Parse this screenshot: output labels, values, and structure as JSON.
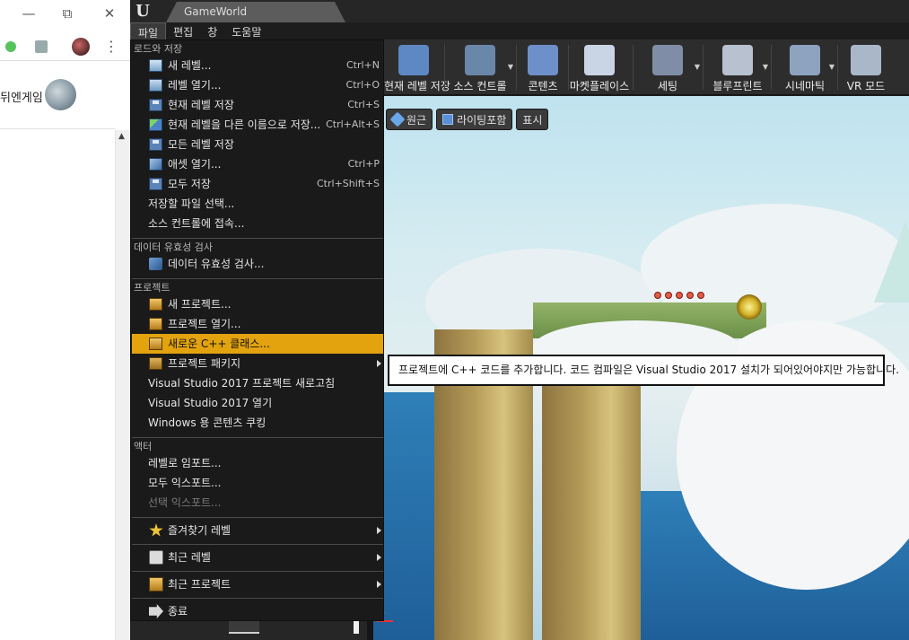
{
  "browser": {
    "window_controls": {
      "minimize": "—",
      "restore": "⧉",
      "close": "✕"
    },
    "kebab": "⋮",
    "site_name": "뒤엔게임",
    "scroll_up": "▲"
  },
  "editor": {
    "logo": "U",
    "tab_title": "GameWorld",
    "menubar": [
      {
        "label": "파일",
        "active": true
      },
      {
        "label": "편집"
      },
      {
        "label": "창"
      },
      {
        "label": "도움말"
      }
    ],
    "toolbar": [
      {
        "label": "현재 레벨 저장",
        "icon": "save-icon",
        "color": "#5d88c4"
      },
      {
        "label": "소스 컨트롤",
        "icon": "source-control-icon",
        "color": "#6a86a8",
        "caret": "▼"
      },
      {
        "label": "콘텐츠",
        "icon": "content-icon",
        "color": "#6d8fca"
      },
      {
        "label": "마켓플레이스",
        "icon": "marketplace-icon",
        "color": "#c9d4e4"
      },
      {
        "label": "세팅",
        "icon": "gear-icon",
        "color": "#7f8ea6",
        "caret": "▼"
      },
      {
        "label": "블루프린트",
        "icon": "blueprint-icon",
        "color": "#b8c1cf",
        "caret": "▼"
      },
      {
        "label": "시네마틱",
        "icon": "cinematic-icon",
        "color": "#8ea3c0",
        "caret": "▼"
      },
      {
        "label": "VR 모드",
        "icon": "vr-icon",
        "color": "#a9b7c9"
      }
    ],
    "viewport_toolbar": [
      {
        "label": "원근",
        "icon": "perspective-icon"
      },
      {
        "label": "라이팅포함",
        "icon": "lit-icon"
      },
      {
        "label": "표시",
        "icon": ""
      }
    ]
  },
  "file_menu": {
    "sections": [
      {
        "header": "로드와 저장",
        "items": [
          {
            "label": "새 레벨...",
            "shortcut": "Ctrl+N",
            "icon": "new-level-icon"
          },
          {
            "label": "레벨 열기...",
            "shortcut": "Ctrl+O",
            "icon": "open-level-icon"
          },
          {
            "label": "현재 레벨 저장",
            "shortcut": "Ctrl+S",
            "icon": "save-level-icon"
          },
          {
            "label": "현재 레벨을 다른 이름으로 저장...",
            "shortcut": "Ctrl+Alt+S",
            "icon": "save-as-icon"
          },
          {
            "label": "모든 레벨 저장",
            "shortcut": "",
            "icon": "save-all-levels-icon"
          },
          {
            "label": "애셋 열기...",
            "shortcut": "Ctrl+P",
            "icon": "open-asset-icon"
          },
          {
            "label": "모두 저장",
            "shortcut": "Ctrl+Shift+S",
            "icon": "save-all-icon"
          },
          {
            "label": "저장할 파일 선택...",
            "shortcut": "",
            "icon": ""
          },
          {
            "label": "소스 컨트롤에 접속...",
            "shortcut": "",
            "icon": ""
          }
        ]
      },
      {
        "header": "데이터 유효성 검사",
        "items": [
          {
            "label": "데이터 유효성 검사...",
            "shortcut": "",
            "icon": "validate-data-icon"
          }
        ]
      },
      {
        "header": "프로젝트",
        "items": [
          {
            "label": "새 프로젝트...",
            "shortcut": "",
            "icon": "new-project-icon"
          },
          {
            "label": "프로젝트 열기...",
            "shortcut": "",
            "icon": "open-project-icon"
          },
          {
            "label": "새로운 C++ 클래스...",
            "shortcut": "",
            "icon": "new-cpp-class-icon",
            "selected": true
          },
          {
            "label": "프로젝트 패키지",
            "shortcut": "",
            "icon": "package-project-icon",
            "submenu": true
          },
          {
            "label": "Visual Studio 2017 프로젝트 새로고침",
            "shortcut": "",
            "icon": ""
          },
          {
            "label": "Visual Studio 2017 열기",
            "shortcut": "",
            "icon": ""
          },
          {
            "label": "Windows 용 콘텐츠 쿠킹",
            "shortcut": "",
            "icon": ""
          }
        ]
      },
      {
        "header": "액터",
        "items": [
          {
            "label": "레벨로 임포트...",
            "shortcut": "",
            "icon": ""
          },
          {
            "label": "모두 익스포트...",
            "shortcut": "",
            "icon": ""
          },
          {
            "label": "선택 익스포트...",
            "shortcut": "",
            "icon": "",
            "disabled": true
          }
        ]
      }
    ],
    "bottom_items": [
      {
        "label": "즐겨찾기 레벨",
        "icon": "star-icon",
        "submenu": true
      },
      {
        "label": "최근 레벨",
        "icon": "recent-level-icon",
        "submenu": true
      },
      {
        "label": "최근 프로젝트",
        "icon": "recent-project-icon",
        "submenu": true
      },
      {
        "label": "종료",
        "icon": "exit-icon",
        "submenu": false
      }
    ]
  },
  "tooltip": {
    "text": "프로젝트에 C++ 코드를 추가합니다. 코드 컴파일은 Visual Studio 2017 설치가 되어있어야지만 가능합니다."
  }
}
